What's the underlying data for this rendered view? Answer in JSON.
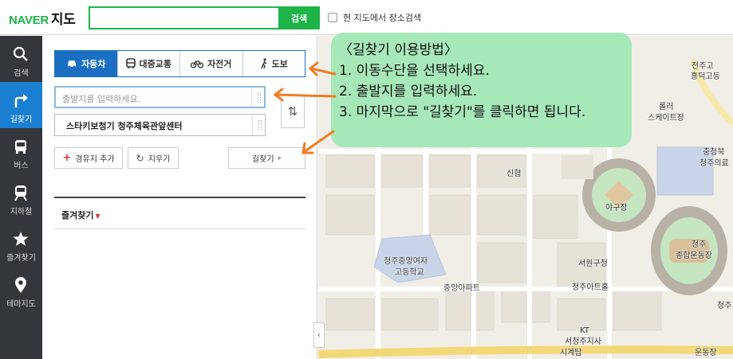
{
  "header": {
    "logo_brand": "NAVER",
    "logo_service": "지도",
    "search_placeholder": "",
    "search_button": "검색",
    "area_search_label": "현 지도에서 장소검색"
  },
  "nav": {
    "items": [
      {
        "label": "검색",
        "icon": "search-icon"
      },
      {
        "label": "길찾기",
        "icon": "route-icon"
      },
      {
        "label": "버스",
        "icon": "bus-icon"
      },
      {
        "label": "지하철",
        "icon": "subway-icon"
      },
      {
        "label": "즐겨찾기",
        "icon": "star-icon"
      },
      {
        "label": "테마지도",
        "icon": "pin-icon"
      }
    ]
  },
  "panel": {
    "tabs": [
      {
        "label": "자동차",
        "icon": "car-icon"
      },
      {
        "label": "대중교통",
        "icon": "bus-icon"
      },
      {
        "label": "자전거",
        "icon": "bicycle-icon"
      },
      {
        "label": "도보",
        "icon": "walk-icon"
      }
    ],
    "origin_placeholder": "출발지를 입력하세요.",
    "destination_value": "스타키보청기 청주체육관앞센터",
    "swap_glyph": "⇅",
    "add_waypoint": "경유지 추가",
    "clear": "지우기",
    "find_route": "길찾기",
    "favorites": "즐겨찾기"
  },
  "callout": {
    "title": "〈길찾기 이용방법〉",
    "step1": "1. 이동수단을 선택하세요.",
    "step2": "2. 출발지를 입력하세요.",
    "step3": "3. 마지막으로 \"길찾기\"를 클릭하면 됩니다."
  },
  "map": {
    "labels": {
      "a": "전주고",
      "b": "흥덕고등",
      "c": "롤러",
      "d": "스케이트장",
      "e": "충청북",
      "f": "청주의료",
      "g": "신협",
      "h": "야구장",
      "i": "청주",
      "j": "종합운동장",
      "k": "청주중앙여자",
      "l": "고등학교",
      "m": "서원구청",
      "n": "중앙아파트",
      "o": "청주아트홀",
      "p": "KT",
      "q": "서청주지사",
      "r": "시계탑",
      "s": "운동장",
      "t": "청주"
    }
  },
  "colors": {
    "naver_green": "#1fb44a",
    "tab_blue": "#1a6fc3",
    "nav_dark": "#33363b",
    "nav_active": "#1a7fd1",
    "callout_green": "#a7e8b8",
    "arrow_orange": "#f07c22"
  }
}
